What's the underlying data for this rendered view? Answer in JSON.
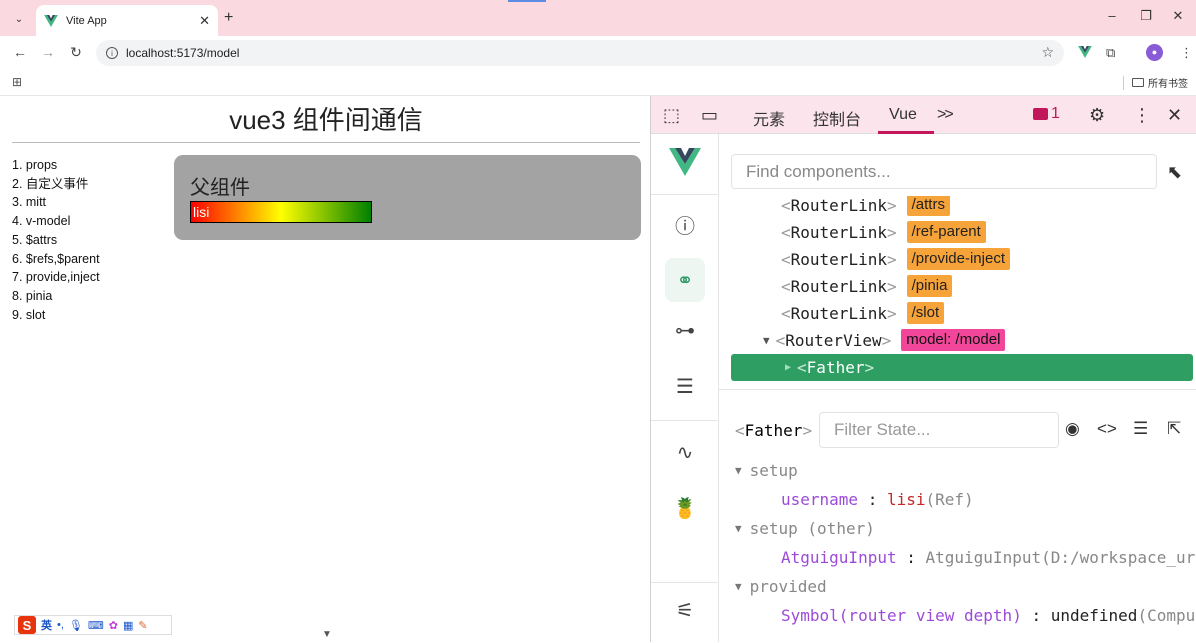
{
  "browser": {
    "tab_title": "Vite App",
    "url": "localhost:5173/model",
    "all_bookmarks_label": "所有书签",
    "colors": {
      "tabbar_bg": "#fbd9e0",
      "vue_green": "#41b883"
    }
  },
  "page": {
    "title": "vue3 组件间通信",
    "nav_items": [
      "1. props",
      "2. 自定义事件",
      "3. mitt",
      "4. v-model",
      "5. $attrs",
      "6. $refs,$parent",
      "7. provide,inject",
      "8. pinia",
      "9. slot"
    ],
    "parent_title": "父组件",
    "username_value": "lisi",
    "ime": {
      "lang_label": "英",
      "dots_label": "•,"
    }
  },
  "devtools": {
    "tabs": {
      "elements": "元素",
      "console": "控制台",
      "vue": "Vue",
      "more": ">>"
    },
    "issues_count": "1",
    "components": {
      "search_placeholder": "Find components...",
      "tree": [
        {
          "name": "RouterLink",
          "tag": "/attrs",
          "tag_color": "orange"
        },
        {
          "name": "RouterLink",
          "tag": "/ref-parent",
          "tag_color": "orange"
        },
        {
          "name": "RouterLink",
          "tag": "/provide-inject",
          "tag_color": "orange"
        },
        {
          "name": "RouterLink",
          "tag": "/pinia",
          "tag_color": "orange"
        },
        {
          "name": "RouterLink",
          "tag": "/slot",
          "tag_color": "orange"
        },
        {
          "name": "RouterView",
          "tag": "model: /model",
          "tag_color": "pink"
        },
        {
          "name": "Father",
          "tag": "",
          "tag_color": ""
        }
      ],
      "selected_name": "Father"
    },
    "state": {
      "component_name": "Father",
      "filter_placeholder": "Filter State...",
      "sections": [
        {
          "title": "setup",
          "entries": [
            {
              "key": "username",
              "value": "lisi",
              "suffix": "(Ref)"
            }
          ]
        },
        {
          "title": "setup (other)",
          "entries": [
            {
              "key": "AtguiguInput",
              "value": "AtguiguInput(D:/workspace_ur",
              "suffix": ""
            }
          ]
        },
        {
          "title": "provided",
          "entries": [
            {
              "key": "Symbol(router view depth)",
              "value": "undefined",
              "suffix": "(Compu"
            }
          ]
        }
      ]
    }
  }
}
